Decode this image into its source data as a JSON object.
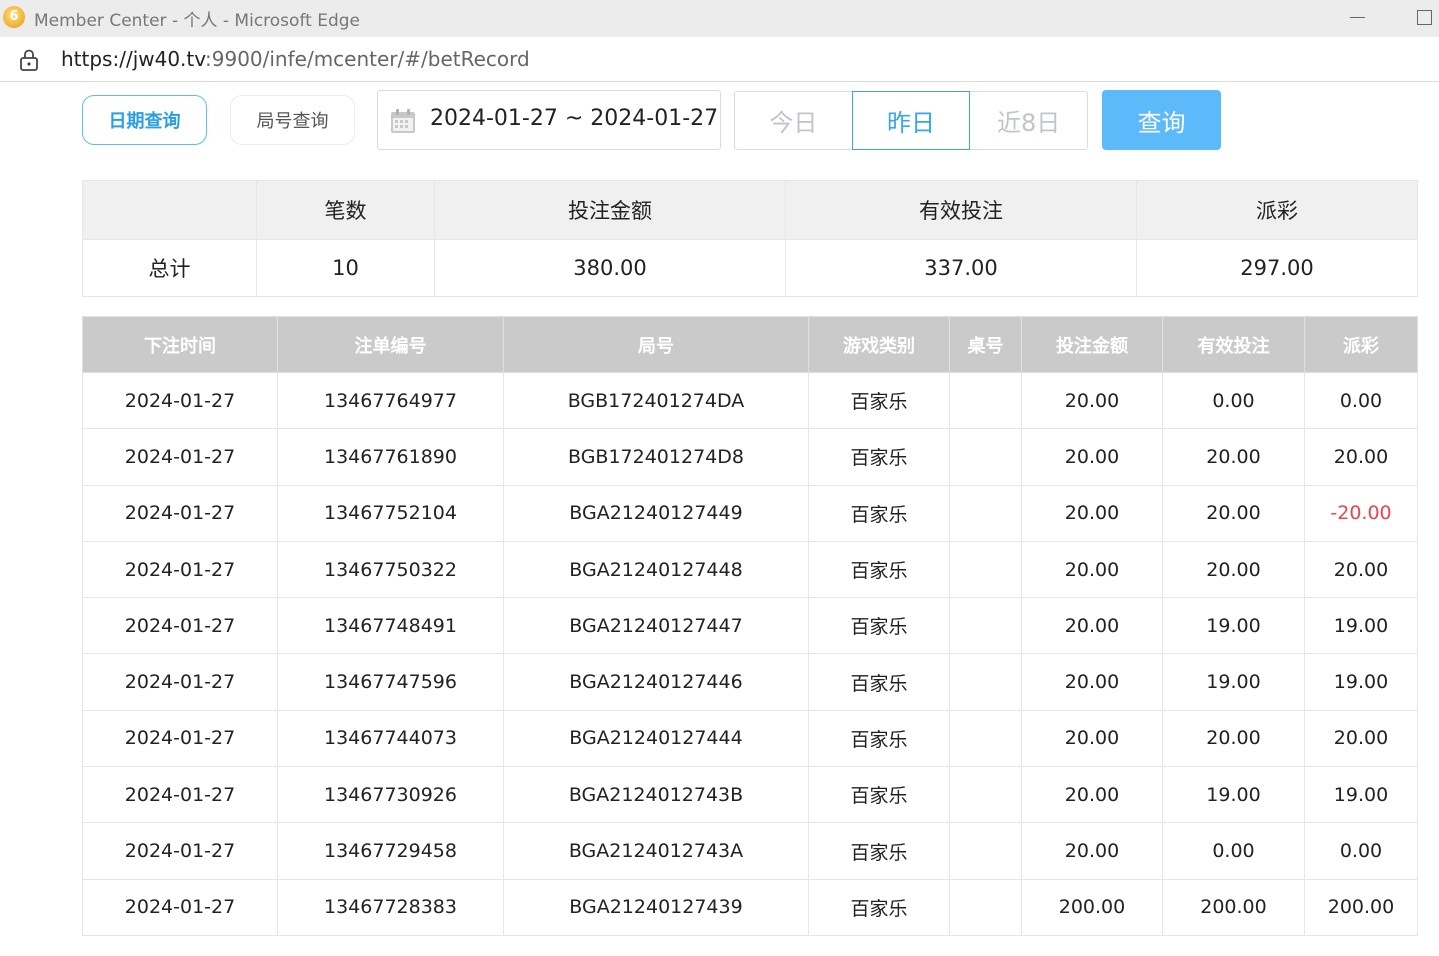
{
  "window": {
    "title": "Member Center - 个人 - Microsoft Edge",
    "icon_glyph": "6"
  },
  "address": {
    "url_host": "https://jw40.tv",
    "url_rest": ":9900/infe/mcenter/#/betRecord"
  },
  "filters": {
    "date_mode_label": "日期查询",
    "round_mode_label": "局号查询",
    "date_range": "2024-01-27 ~ 2024-01-27",
    "quick": [
      "今日",
      "昨日",
      "近8日"
    ],
    "quick_selected": "昨日",
    "query_label": "查询"
  },
  "summary": {
    "headers": [
      "",
      "笔数",
      "投注金额",
      "有效投注",
      "派彩"
    ],
    "row": [
      "总计",
      "10",
      "380.00",
      "337.00",
      "297.00"
    ]
  },
  "records": {
    "headers": [
      "下注时间",
      "注单编号",
      "局号",
      "游戏类别",
      "桌号",
      "投注金额",
      "有效投注",
      "派彩"
    ],
    "rows": [
      [
        "2024-01-27",
        "13467764977",
        "BGB172401274DA",
        "百家乐",
        "",
        "20.00",
        "0.00",
        "0.00"
      ],
      [
        "2024-01-27",
        "13467761890",
        "BGB172401274D8",
        "百家乐",
        "",
        "20.00",
        "20.00",
        "20.00"
      ],
      [
        "2024-01-27",
        "13467752104",
        "BGA21240127449",
        "百家乐",
        "",
        "20.00",
        "20.00",
        "-20.00"
      ],
      [
        "2024-01-27",
        "13467750322",
        "BGA21240127448",
        "百家乐",
        "",
        "20.00",
        "20.00",
        "20.00"
      ],
      [
        "2024-01-27",
        "13467748491",
        "BGA21240127447",
        "百家乐",
        "",
        "20.00",
        "19.00",
        "19.00"
      ],
      [
        "2024-01-27",
        "13467747596",
        "BGA21240127446",
        "百家乐",
        "",
        "20.00",
        "19.00",
        "19.00"
      ],
      [
        "2024-01-27",
        "13467744073",
        "BGA21240127444",
        "百家乐",
        "",
        "20.00",
        "20.00",
        "20.00"
      ],
      [
        "2024-01-27",
        "13467730926",
        "BGA2124012743B",
        "百家乐",
        "",
        "20.00",
        "19.00",
        "19.00"
      ],
      [
        "2024-01-27",
        "13467729458",
        "BGA2124012743A",
        "百家乐",
        "",
        "20.00",
        "0.00",
        "0.00"
      ],
      [
        "2024-01-27",
        "13467728383",
        "BGA21240127439",
        "百家乐",
        "",
        "200.00",
        "200.00",
        "200.00"
      ]
    ]
  },
  "colors": {
    "accent": "#3aa5ec",
    "query_button": "#5cb9fa",
    "negative": "#f0414e",
    "header_bg": "#cacaca"
  }
}
